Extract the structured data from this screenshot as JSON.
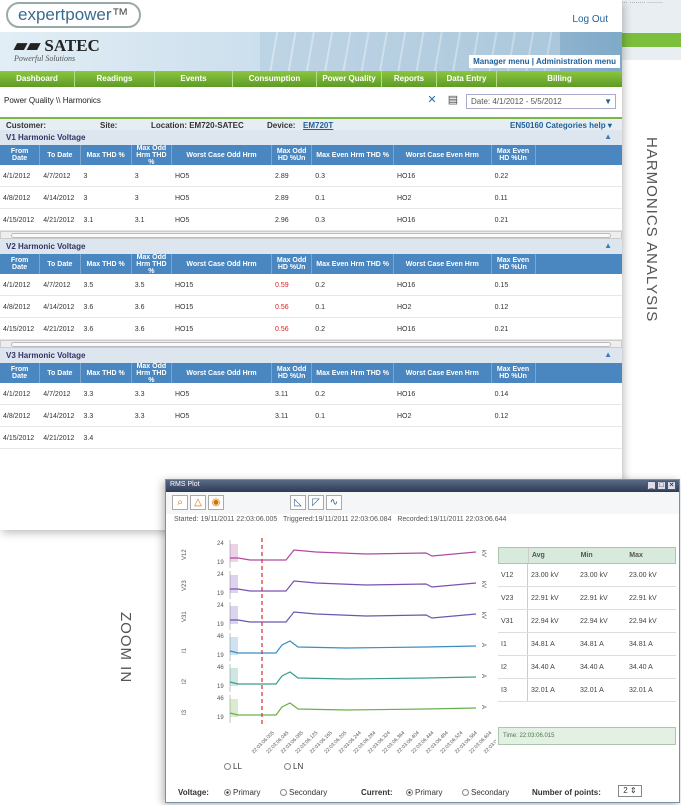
{
  "brand": {
    "name": "expertpower",
    "satec": "SATEC",
    "tagline": "Powerful Solutions"
  },
  "header": {
    "logout": "Log Out",
    "manager_menu": "Manager menu",
    "separator": "|",
    "admin_menu": "Administration menu"
  },
  "nav": [
    "Dashboard",
    "Readings",
    "Events",
    "Consumption",
    "Power Quality",
    "Reports",
    "Data Entry",
    "Billing"
  ],
  "breadcrumb": "Power Quality \\\\ Harmonics",
  "date_range": "Date: 4/1/2012 - 5/5/2012",
  "info": {
    "customer": "Customer:",
    "site": "Site:",
    "location": "Location: EM720-SATEC",
    "device_label": "Device:",
    "device": "EM720T",
    "help": "EN50160 Categories help ▾"
  },
  "columns": [
    "From Date",
    "To Date",
    "Max THD %",
    "Max Odd Hrm THD %",
    "Worst Case Odd Hrm",
    "Max Odd HD %Un",
    "Max Even Hrm THD %",
    "Worst Case Even Hrm",
    "Max Even HD %Un"
  ],
  "sections": [
    {
      "title": "V1 Harmonic Voltage",
      "rows": [
        [
          "4/1/2012",
          "4/7/2012",
          "3",
          "3",
          "HO5",
          "2.89",
          "0.3",
          "HO16",
          "0.22"
        ],
        [
          "4/8/2012",
          "4/14/2012",
          "3",
          "3",
          "HO5",
          "2.89",
          "0.1",
          "HO2",
          "0.11"
        ],
        [
          "4/15/2012",
          "4/21/2012",
          "3.1",
          "3.1",
          "HO5",
          "2.96",
          "0.3",
          "HO16",
          "0.21"
        ]
      ]
    },
    {
      "title": "V2 Harmonic Voltage",
      "rows": [
        [
          "4/1/2012",
          "4/7/2012",
          "3.5",
          "3.5",
          "HO15",
          "0.59",
          "0.2",
          "HO16",
          "0.15"
        ],
        [
          "4/8/2012",
          "4/14/2012",
          "3.6",
          "3.6",
          "HO15",
          "0.56",
          "0.1",
          "HO2",
          "0.12"
        ],
        [
          "4/15/2012",
          "4/21/2012",
          "3.6",
          "3.6",
          "HO15",
          "0.56",
          "0.2",
          "HO16",
          "0.21"
        ]
      ]
    },
    {
      "title": "V3 Harmonic Voltage",
      "rows": [
        [
          "4/1/2012",
          "4/7/2012",
          "3.3",
          "3.3",
          "HO5",
          "3.11",
          "0.2",
          "HO16",
          "0.14"
        ],
        [
          "4/8/2012",
          "4/14/2012",
          "3.3",
          "3.3",
          "HO5",
          "3.11",
          "0.1",
          "HO2",
          "0.12"
        ],
        [
          "4/15/2012",
          "4/21/2012",
          "3.4",
          "",
          "",
          "",
          "",
          "",
          ""
        ]
      ]
    }
  ],
  "side_labels": {
    "harmonics": "HARMONICS ANALYSIS",
    "zoom": "ZOOM IN"
  },
  "rms": {
    "title": "RMS Plot",
    "started": "Started: 19/11/2011 22:03:06.005",
    "triggered": "Triggered:19/11/2011 22:03:06.084",
    "recorded": "Recorded:19/11/2011 22:03:06.644",
    "channels": [
      {
        "name": "V12",
        "hi": "24",
        "lo": "19",
        "unit": "kV"
      },
      {
        "name": "V23",
        "hi": "24",
        "lo": "19",
        "unit": "kV"
      },
      {
        "name": "V31",
        "hi": "24",
        "lo": "19",
        "unit": "kV"
      },
      {
        "name": "I1",
        "hi": "46",
        "lo": "19",
        "unit": "A"
      },
      {
        "name": "I2",
        "hi": "46",
        "lo": "19",
        "unit": "A"
      },
      {
        "name": "I3",
        "hi": "46",
        "lo": "19",
        "unit": "A"
      }
    ],
    "x_ticks": [
      "22:03:06.005",
      "22:03:06.045",
      "22:03:06.085",
      "22:03:06.125",
      "22:03:06.165",
      "22:03:06.205",
      "22:03:06.244",
      "22:03:06.284",
      "22:03:06.324",
      "22:03:06.364",
      "22:03:06.404",
      "22:03:06.444",
      "22:03:06.484",
      "22:03:06.524",
      "22:03:06.564",
      "22:03:06.604",
      "22:03:06.644"
    ],
    "table_head": [
      "",
      "Avg",
      "Min",
      "Max"
    ],
    "table": [
      [
        "V12",
        "23.00 kV",
        "23.00 kV",
        "23.00 kV"
      ],
      [
        "V23",
        "22.91 kV",
        "22.91 kV",
        "22.91 kV"
      ],
      [
        "V31",
        "22.94 kV",
        "22.94 kV",
        "22.94 kV"
      ],
      [
        "I1",
        "34.81 A",
        "34.81 A",
        "34.81 A"
      ],
      [
        "I2",
        "34.40 A",
        "34.40 A",
        "34.40 A"
      ],
      [
        "I3",
        "32.01 A",
        "32.01 A",
        "32.01 A"
      ]
    ],
    "time": "Time:  22:03:06.015",
    "controls": {
      "ll": "LL",
      "ln": "LN",
      "voltage": "Voltage:",
      "primary": "Primary",
      "secondary": "Secondary",
      "current": "Current:",
      "points": "Number of points:",
      "points_value": "2"
    }
  },
  "colors": {
    "green": "#7bb743",
    "blue_header": "#4a86c0",
    "red_value": "#e02020",
    "trigger_line": "#d9302b"
  }
}
